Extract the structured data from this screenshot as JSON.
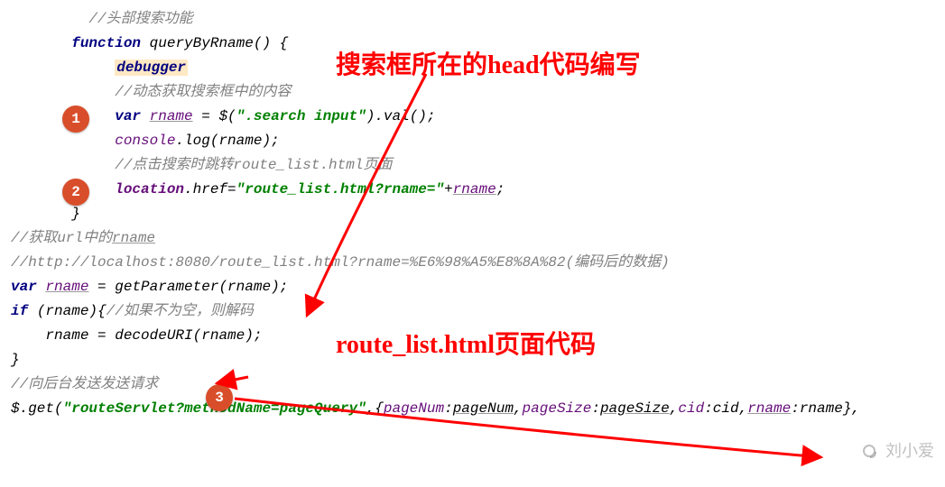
{
  "code": {
    "l1": "//头部搜索功能",
    "l2a": "function",
    "l2b": " queryByRname",
    "l2c": "() {",
    "l3": "debugger",
    "l4": "//动态获取搜索框中的内容",
    "l5a": "var ",
    "l5b": "rname",
    "l5c": " = $(",
    "l5d": "\".search input\"",
    "l5e": ").val();",
    "l6a": "console",
    "l6b": ".log(rname);",
    "l7": "//点击搜索时跳转route_list.html页面",
    "l8a": "location",
    "l8b": ".href=",
    "l8c": "\"route_list.html?rname=\"",
    "l8d": "+",
    "l8e": "rname",
    "l8f": ";",
    "l9": "}",
    "l10a": "//获取url中的",
    "l10b": "rname",
    "l11": "//http://localhost:8080/route_list.html?rname=%E6%98%A5%E8%8A%82(编码后的数据)",
    "l12a": "var ",
    "l12b": "rname",
    "l12c": " = ",
    "l12d": "getParameter",
    "l12e": "(rname);",
    "l13a": "if ",
    "l13b": "(rname){",
    "l13c": "//如果不为空，则解码",
    "l14a": "rname = ",
    "l14b": "decodeURI",
    "l14c": "(rname);",
    "l15": "}",
    "l16": "//向后台发送发送请求",
    "l17a": "$.get(",
    "l17b": "\"routeServlet?methodName=pageQuery\"",
    "l17c": ",{",
    "l17d": "pageNum",
    "l17e": ":",
    "l17f": "pageNum",
    "l17g": ",",
    "l17h": "pageSize",
    "l17i": ":",
    "l17j": "pageSize",
    "l17k": ",",
    "l17l": "cid",
    "l17m": ":cid,",
    "l17n": "rname",
    "l17o": ":rname},"
  },
  "badges": {
    "b1": "1",
    "b2": "2",
    "b3": "3"
  },
  "annotations": {
    "a1": "搜索框所在的head代码编写",
    "a2": "route_list.html页面代码"
  },
  "watermark": "刘小爱"
}
